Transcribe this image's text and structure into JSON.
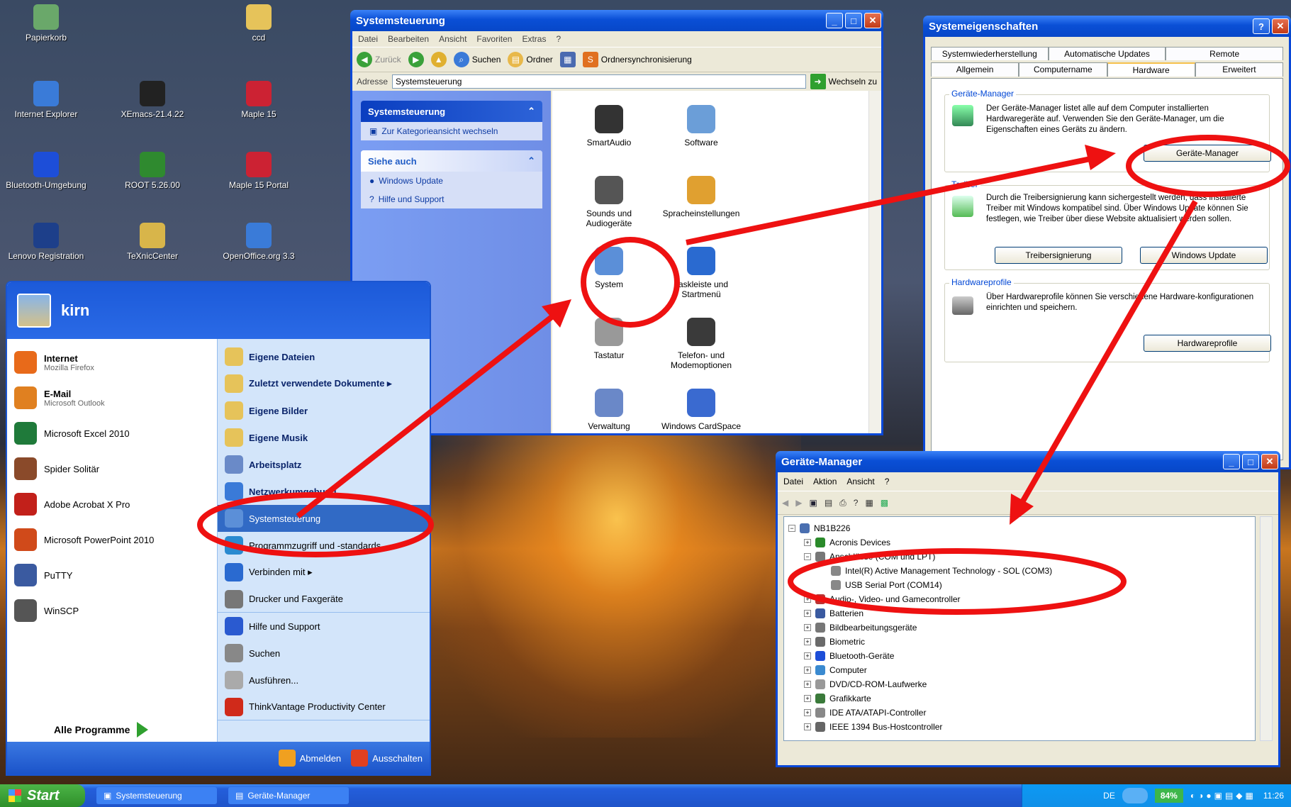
{
  "desktop": {
    "icons": [
      {
        "label": "Papierkorb",
        "icon": "recycle-bin-icon"
      },
      {
        "label": "ccd",
        "icon": "folder-icon"
      },
      {
        "label": "Internet Explorer",
        "icon": "ie-icon"
      },
      {
        "label": "XEmacs-21.4.22",
        "icon": "xemacs-icon"
      },
      {
        "label": "Maple 15",
        "icon": "maple-icon"
      },
      {
        "label": "Bluetooth-Umgebung",
        "icon": "bluetooth-icon"
      },
      {
        "label": "ROOT 5.26.00",
        "icon": "root-icon"
      },
      {
        "label": "Maple 15 Portal",
        "icon": "maple-portal-icon"
      },
      {
        "label": "Lenovo Registration",
        "icon": "lenovo-icon"
      },
      {
        "label": "TeXnicCenter",
        "icon": "texniccenter-icon"
      },
      {
        "label": "OpenOffice.org 3.3",
        "icon": "openoffice-icon"
      }
    ]
  },
  "control_panel": {
    "title": "Systemsteuerung",
    "menu": [
      "Datei",
      "Bearbeiten",
      "Ansicht",
      "Favoriten",
      "Extras",
      "?"
    ],
    "toolbar": {
      "back": "Zurück",
      "search": "Suchen",
      "folders": "Ordner",
      "sync": "Ordnersynchronisierung"
    },
    "address_label": "Adresse",
    "address_value": "Systemsteuerung",
    "go_label": "Wechseln zu",
    "panel1_title": "Systemsteuerung",
    "panel1_link": "Zur Kategorieansicht wechseln",
    "panel2_title": "Siehe auch",
    "panel2_links": [
      "Windows Update",
      "Hilfe und Support"
    ],
    "items": [
      "SmartAudio",
      "Software",
      "Sounds und Audiogeräte",
      "Spracheinstellungen",
      "System",
      "Taskleiste und Startmenü",
      "Tastatur",
      "Telefon- und Modemoptionen",
      "Verwaltung",
      "Windows CardSpace"
    ]
  },
  "system_properties": {
    "title": "Systemeigenschaften",
    "tabs_row1": [
      "Systemwiederherstellung",
      "Automatische Updates",
      "Remote"
    ],
    "tabs_row2": [
      "Allgemein",
      "Computername",
      "Hardware",
      "Erweitert"
    ],
    "devmgr_group": "Geräte-Manager",
    "devmgr_text": "Der Geräte-Manager listet alle auf dem Computer installierten Hardwaregeräte auf. Verwenden Sie den Geräte-Manager, um die Eigenschaften eines Geräts zu ändern.",
    "devmgr_button": "Geräte-Manager",
    "driver_group": "Treiber",
    "driver_text": "Durch die Treibersignierung kann sichergestellt werden, dass installierte Treiber mit Windows kompatibel sind. Über Windows Update können Sie festlegen, wie Treiber über diese Website aktualisiert werden sollen.",
    "driver_btn1": "Treibersignierung",
    "driver_btn2": "Windows Update",
    "profiles_group": "Hardwareprofile",
    "profiles_text": "Über Hardwareprofile können Sie verschiedene Hardware-konfigurationen einrichten und speichern.",
    "profiles_button": "Hardwareprofile"
  },
  "start_menu": {
    "user": "kirn",
    "left": [
      {
        "title": "Internet",
        "sub": "Mozilla Firefox",
        "icon": "firefox-icon",
        "bold": true
      },
      {
        "title": "E-Mail",
        "sub": "Microsoft Outlook",
        "icon": "outlook-icon",
        "bold": true
      },
      {
        "title": "Microsoft Excel 2010",
        "sub": "",
        "icon": "excel-icon",
        "bold": false
      },
      {
        "title": "Spider Solitär",
        "sub": "",
        "icon": "spider-solitaire-icon",
        "bold": false
      },
      {
        "title": "Adobe Acrobat X Pro",
        "sub": "",
        "icon": "acrobat-icon",
        "bold": false
      },
      {
        "title": "Microsoft PowerPoint 2010",
        "sub": "",
        "icon": "powerpoint-icon",
        "bold": false
      },
      {
        "title": "PuTTY",
        "sub": "",
        "icon": "putty-icon",
        "bold": false
      },
      {
        "title": "WinSCP",
        "sub": "",
        "icon": "winscp-icon",
        "bold": false
      }
    ],
    "all_programs": "Alle Programme",
    "right": [
      {
        "label": "Eigene Dateien",
        "bold": true
      },
      {
        "label": "Zuletzt verwendete Dokumente ▸",
        "bold": true
      },
      {
        "label": "Eigene Bilder",
        "bold": true
      },
      {
        "label": "Eigene Musik",
        "bold": true
      },
      {
        "label": "Arbeitsplatz",
        "bold": true
      },
      {
        "label": "Netzwerkumgebung",
        "bold": true
      },
      {
        "label": "Systemsteuerung",
        "bold": false
      },
      {
        "label": "Programmzugriff und -standards",
        "bold": false
      },
      {
        "label": "Verbinden mit ▸",
        "bold": false
      },
      {
        "label": "Drucker und Faxgeräte",
        "bold": false
      },
      {
        "label": "Hilfe und Support",
        "bold": false
      },
      {
        "label": "Suchen",
        "bold": false
      },
      {
        "label": "Ausführen...",
        "bold": false
      },
      {
        "label": "ThinkVantage Productivity Center",
        "bold": false
      }
    ],
    "logoff": "Abmelden",
    "shutdown": "Ausschalten"
  },
  "device_manager": {
    "title": "Geräte-Manager",
    "menu": [
      "Datei",
      "Aktion",
      "Ansicht",
      "?"
    ],
    "root": "NB1B226",
    "tree": [
      {
        "label": "Acronis Devices",
        "level": 1,
        "pm": "+"
      },
      {
        "label": "Anschlüsse (COM und LPT)",
        "level": 1,
        "pm": "−"
      },
      {
        "label": "Intel(R) Active Management Technology - SOL (COM3)",
        "level": 2,
        "pm": ""
      },
      {
        "label": "USB Serial Port (COM14)",
        "level": 2,
        "pm": ""
      },
      {
        "label": "Audio-, Video- und Gamecontroller",
        "level": 1,
        "pm": "+"
      },
      {
        "label": "Batterien",
        "level": 1,
        "pm": "+"
      },
      {
        "label": "Bildbearbeitungsgeräte",
        "level": 1,
        "pm": "+"
      },
      {
        "label": "Biometric",
        "level": 1,
        "pm": "+"
      },
      {
        "label": "Bluetooth-Geräte",
        "level": 1,
        "pm": "+"
      },
      {
        "label": "Computer",
        "level": 1,
        "pm": "+"
      },
      {
        "label": "DVD/CD-ROM-Laufwerke",
        "level": 1,
        "pm": "+"
      },
      {
        "label": "Grafikkarte",
        "level": 1,
        "pm": "+"
      },
      {
        "label": "IDE ATA/ATAPI-Controller",
        "level": 1,
        "pm": "+"
      },
      {
        "label": "IEEE 1394 Bus-Hostcontroller",
        "level": 1,
        "pm": "+"
      }
    ]
  },
  "taskbar": {
    "start": "Start",
    "tasks": [
      "Systemsteuerung",
      "Geräte-Manager"
    ],
    "lang": "DE",
    "battery": "84%",
    "clock": "11:26"
  },
  "colors": {
    "annotation_red": "#ee1111",
    "xp_blue": "#0a48d8"
  }
}
